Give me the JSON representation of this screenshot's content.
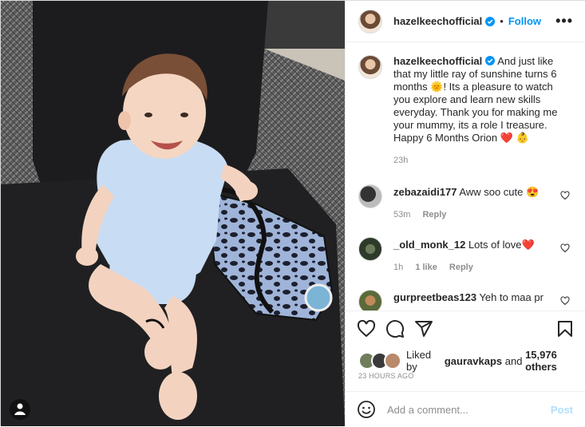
{
  "post": {
    "username": "hazelkeechofficial",
    "follow_label": "Follow",
    "dot": "•",
    "more_label": "•••"
  },
  "caption": {
    "username": "hazelkeechofficial",
    "text_before": "And just like that my little ray of sunshine turns 6 months",
    "emoji_sun": "🌞",
    "text_after": "! Its a pleasure to watch you explore and learn new skills everyday. Thank you for making me your mummy, its a role I treasure. Happy 6 Months Orion",
    "emoji_heart": "❤️",
    "emoji_baby": "👶",
    "time": "23h"
  },
  "comments": [
    {
      "username": "zebazaidi177",
      "text": "Aww soo cute",
      "emoji": "😍",
      "time": "53m",
      "likes": "",
      "reply": "Reply"
    },
    {
      "username": "_old_monk_12",
      "text": "Lots of love",
      "emoji": "❤️",
      "time": "1h",
      "likes": "1 like",
      "reply": "Reply"
    },
    {
      "username": "gurpreetbeas123",
      "text": "Yeh to maa pr",
      "emoji": "",
      "time": "",
      "likes": "",
      "reply": ""
    }
  ],
  "likes": {
    "prefix": "Liked by",
    "user": "gauravkaps",
    "middle": "and",
    "others": "15,976 others"
  },
  "timestamp": "23 HOURS AGO",
  "comment_box": {
    "placeholder": "Add a comment...",
    "post_label": "Post"
  },
  "colors": {
    "accent": "#0095f6",
    "post_disabled": "#b2dffc",
    "like_red": "#ed4956"
  }
}
